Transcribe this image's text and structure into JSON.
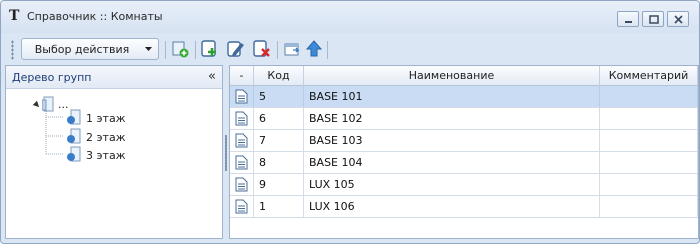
{
  "window": {
    "title": "Справочник :: Комнаты",
    "controls": [
      "minimize",
      "maximize",
      "close"
    ]
  },
  "toolbar": {
    "action_dropdown": "Выбор действия",
    "buttons": [
      "add-record-icon",
      "add-icon",
      "edit-icon",
      "delete-icon",
      "export-icon",
      "upload-icon"
    ]
  },
  "left_panel": {
    "title": "Дерево групп",
    "collapse": "«",
    "tree": {
      "root": "...",
      "children": [
        "1 этаж",
        "2 этаж",
        "3 этаж"
      ]
    }
  },
  "grid": {
    "columns": [
      "-",
      "Код",
      "Наименование",
      "Комментарий"
    ],
    "rows": [
      {
        "code": "5",
        "name": "BASE 101",
        "comment": ""
      },
      {
        "code": "6",
        "name": "BASE 102",
        "comment": ""
      },
      {
        "code": "7",
        "name": "BASE 103",
        "comment": ""
      },
      {
        "code": "8",
        "name": "BASE 104",
        "comment": ""
      },
      {
        "code": "9",
        "name": "LUX 105",
        "comment": ""
      },
      {
        "code": "1",
        "name": "LUX 106",
        "comment": ""
      }
    ],
    "selected_row": 0
  },
  "colors": {
    "accent": "#1e3e78",
    "selection": "#c9dcf4",
    "frame": "#dbe6f4"
  }
}
